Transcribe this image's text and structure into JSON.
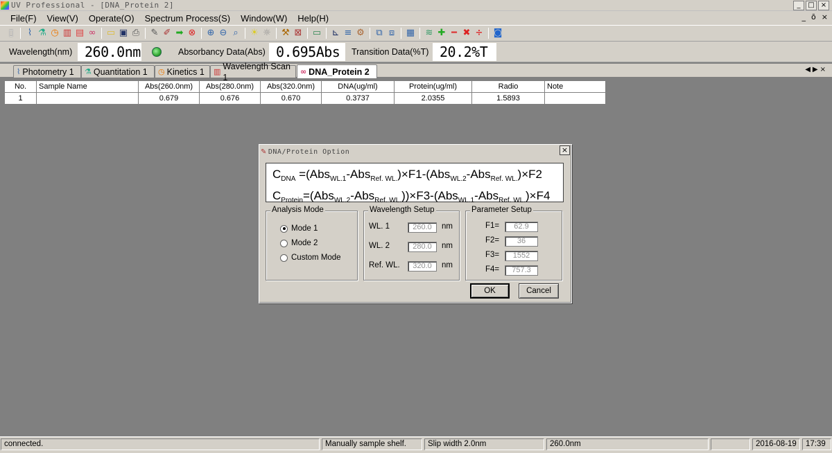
{
  "window": {
    "title": "UV Professional - [DNA_Protein 2]",
    "controls": {
      "minimize": "_",
      "maximize": "□",
      "close": "×"
    },
    "mdi_controls": {
      "minimize": "_",
      "restore": "ō",
      "close": "×"
    }
  },
  "menu": [
    "File(F)",
    "View(V)",
    "Operate(O)",
    "Spectrum Process(S)",
    "Window(W)",
    "Help(H)"
  ],
  "toolbar": {
    "icons": [
      "new-document-icon",
      "line-chart-icon",
      "flask-icon",
      "clock-icon",
      "color-bars-icon",
      "bar-chart-icon",
      "dna-icon",
      "open-folder-icon",
      "save-icon",
      "print-icon",
      "pencil-icon",
      "eraser-icon",
      "forward-icon",
      "stop-icon",
      "zoom-in-icon",
      "zoom-out-icon",
      "zoom-fit-icon",
      "bulb-icon",
      "bulb-off-icon",
      "peak-pick-icon",
      "scan-icon",
      "baseline-icon",
      "axis-icon",
      "data-icon",
      "tools-icon",
      "window-icon",
      "edit-window-icon",
      "grid-icon",
      "stack-icon",
      "plus-icon",
      "minus-icon",
      "multiply-icon",
      "divide-icon",
      "target-icon"
    ]
  },
  "databar": {
    "wavelength_label": "Wavelength(nm)",
    "wavelength_value": "260.0nm",
    "absorbance_label": "Absorbancy Data(Abs)",
    "absorbance_value": "0.695Abs",
    "transition_label": "Transition Data(%T)",
    "transition_value": "20.2%T"
  },
  "tabs": [
    {
      "label": "Photometry 1",
      "icon": "photometry-icon",
      "active": false
    },
    {
      "label": "Quantitation 1",
      "icon": "flask-icon",
      "active": false
    },
    {
      "label": "Kinetics 1",
      "icon": "clock-icon",
      "active": false
    },
    {
      "label": "Wavelength Scan 1",
      "icon": "spectrum-icon",
      "active": false
    },
    {
      "label": "DNA_Protein 2",
      "icon": "dna-icon",
      "active": true
    }
  ],
  "table": {
    "headers": [
      "No.",
      "Sample Name",
      "Abs(260.0nm)",
      "Abs(280.0nm)",
      "Abs(320.0nm)",
      "DNA(ug/ml)",
      "Protein(ug/ml)",
      "Radio",
      "Note"
    ],
    "rows": [
      [
        "1",
        "",
        "0.679",
        "0.676",
        "0.670",
        "0.3737",
        "2.0355",
        "1.5893",
        ""
      ]
    ]
  },
  "dialog": {
    "title": "DNA/Protein Option",
    "formula": {
      "c": "C",
      "dna_sub": "DNA",
      "protein_sub": "Protein",
      "abs": "Abs",
      "wl1": "WL.1",
      "wl2": "WL.2",
      "ref": "Ref. WL.",
      "f1": "×F1-(",
      "f2": ")×F2",
      "f3": ")×F3-(",
      "f4": ")×F4",
      "eq_open": "=(",
      "minus": "-",
      "close": ")"
    },
    "analysis_mode": {
      "title": "Analysis Mode",
      "options": [
        "Mode 1",
        "Mode 2",
        "Custom Mode"
      ],
      "selected": "Mode 1"
    },
    "wavelength_setup": {
      "title": "Wavelength Setup",
      "rows": [
        {
          "label": "WL. 1",
          "value": "260.0",
          "unit": "nm"
        },
        {
          "label": "WL. 2",
          "value": "280.0",
          "unit": "nm"
        },
        {
          "label": "Ref. WL.",
          "value": "320.0",
          "unit": "nm"
        }
      ]
    },
    "parameter_setup": {
      "title": "Parameter Setup",
      "rows": [
        {
          "label": "F1=",
          "value": "62.9"
        },
        {
          "label": "F2=",
          "value": "36"
        },
        {
          "label": "F3=",
          "value": "1552"
        },
        {
          "label": "F4=",
          "value": "757.3"
        }
      ]
    },
    "ok": "OK",
    "cancel": "Cancel"
  },
  "statusbar": {
    "state": "connected.",
    "sample_shelf": "Manually sample shelf.",
    "slip_width": "Slip width 2.0nm",
    "wavelength": "260.0nm",
    "empty": "",
    "date": "2016-08-19",
    "time": "17:39"
  }
}
